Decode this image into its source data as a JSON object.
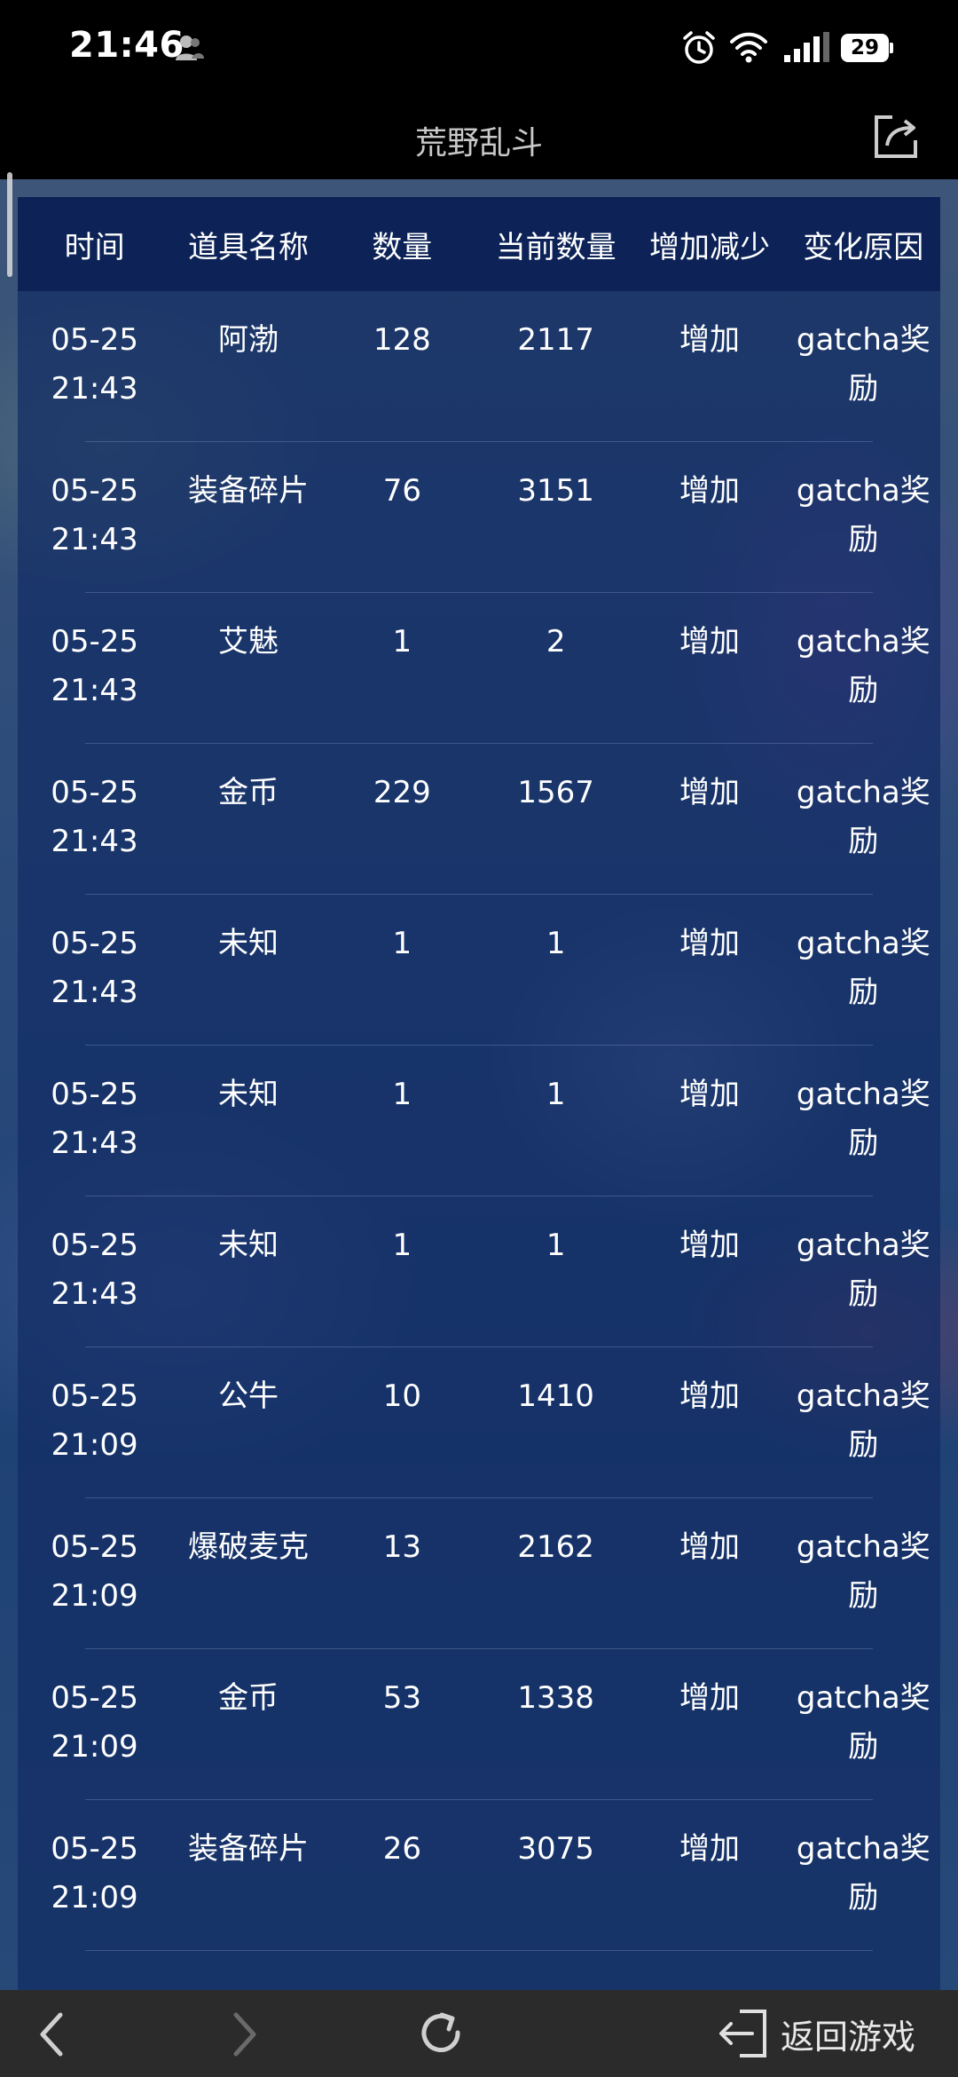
{
  "status_bar": {
    "time": "21:46",
    "battery": "29",
    "icons": [
      "person-icon",
      "alarm-icon",
      "wifi-icon",
      "signal-icon",
      "battery-icon"
    ]
  },
  "header": {
    "title": "荒野乱斗",
    "share_icon": "share-icon"
  },
  "table": {
    "headers": [
      "时间",
      "道具名称",
      "数量",
      "当前数量",
      "增加减少",
      "变化原因"
    ],
    "rows": [
      {
        "date": "05-25",
        "time": "21:43",
        "item": "阿渤",
        "qty": "128",
        "current": "2117",
        "change": "增加",
        "reason": "gatcha奖励"
      },
      {
        "date": "05-25",
        "time": "21:43",
        "item": "装备碎片",
        "qty": "76",
        "current": "3151",
        "change": "增加",
        "reason": "gatcha奖励"
      },
      {
        "date": "05-25",
        "time": "21:43",
        "item": "艾魅",
        "qty": "1",
        "current": "2",
        "change": "增加",
        "reason": "gatcha奖励"
      },
      {
        "date": "05-25",
        "time": "21:43",
        "item": "金币",
        "qty": "229",
        "current": "1567",
        "change": "增加",
        "reason": "gatcha奖励"
      },
      {
        "date": "05-25",
        "time": "21:43",
        "item": "未知",
        "qty": "1",
        "current": "1",
        "change": "增加",
        "reason": "gatcha奖励"
      },
      {
        "date": "05-25",
        "time": "21:43",
        "item": "未知",
        "qty": "1",
        "current": "1",
        "change": "增加",
        "reason": "gatcha奖励"
      },
      {
        "date": "05-25",
        "time": "21:43",
        "item": "未知",
        "qty": "1",
        "current": "1",
        "change": "增加",
        "reason": "gatcha奖励"
      },
      {
        "date": "05-25",
        "time": "21:09",
        "item": "公牛",
        "qty": "10",
        "current": "1410",
        "change": "增加",
        "reason": "gatcha奖励"
      },
      {
        "date": "05-25",
        "time": "21:09",
        "item": "爆破麦克",
        "qty": "13",
        "current": "2162",
        "change": "增加",
        "reason": "gatcha奖励"
      },
      {
        "date": "05-25",
        "time": "21:09",
        "item": "金币",
        "qty": "53",
        "current": "1338",
        "change": "增加",
        "reason": "gatcha奖励"
      },
      {
        "date": "05-25",
        "time": "21:09",
        "item": "装备碎片",
        "qty": "26",
        "current": "3075",
        "change": "增加",
        "reason": "gatcha奖励"
      }
    ]
  },
  "bottom_nav": {
    "back_icon": "chevron-left-icon",
    "forward_icon": "chevron-right-icon",
    "refresh_icon": "refresh-icon",
    "return_label": "返回游戏",
    "return_icon": "exit-icon"
  }
}
